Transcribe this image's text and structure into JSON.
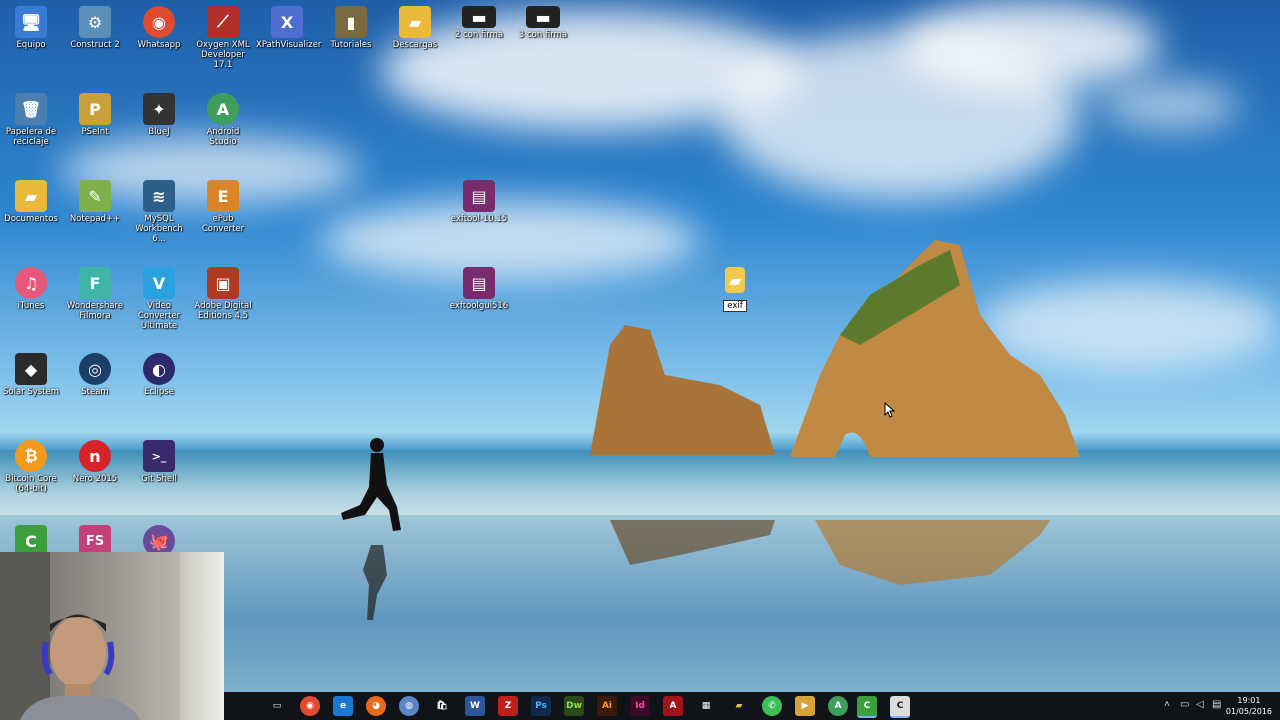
{
  "desktop_icons": [
    {
      "label": "Equipo",
      "glyph": "🖥",
      "color": "#3a7bd5"
    },
    {
      "label": "Construct 2",
      "glyph": "⚙",
      "color": "#5b8fb9"
    },
    {
      "label": "Whatsapp",
      "glyph": "◉",
      "color": "#e04a2f"
    },
    {
      "label": "Oxygen XML Developer 17.1",
      "glyph": "⟋",
      "color": "#b2302a"
    },
    {
      "label": "XPathVisualizer",
      "glyph": "X",
      "color": "#4f6fd0"
    },
    {
      "label": "Tutoriales",
      "glyph": "▮",
      "color": "#7a6a40"
    },
    {
      "label": "Descargas",
      "glyph": "▰",
      "color": "#e8b93a"
    },
    {
      "label": "2 con firma",
      "glyph": "▬",
      "color": "#222"
    },
    {
      "label": "3 con firma",
      "glyph": "▬",
      "color": "#222"
    },
    {
      "label": "Papelera de reciclaje",
      "glyph": "🗑",
      "color": "#4b7fb0"
    },
    {
      "label": "PSeInt",
      "glyph": "P",
      "color": "#c9a13a"
    },
    {
      "label": "BlueJ",
      "glyph": "✦",
      "color": "#333"
    },
    {
      "label": "Android Studio",
      "glyph": "A",
      "color": "#3f9e5a"
    },
    {
      "label": "Documentos",
      "glyph": "▰",
      "color": "#e8b93a"
    },
    {
      "label": "Notepad++",
      "glyph": "✎",
      "color": "#7fb04a"
    },
    {
      "label": "MySQL Workbench 6...",
      "glyph": "≋",
      "color": "#2e5f8a"
    },
    {
      "label": "ePub Converter",
      "glyph": "E",
      "color": "#d9852a"
    },
    {
      "label": "exftool-10.15",
      "glyph": "▤",
      "color": "#7a2b6e"
    },
    {
      "label": "iTunes",
      "glyph": "♫",
      "color": "#e6577a"
    },
    {
      "label": "Wondershare Filmora",
      "glyph": "F",
      "color": "#3fb5a8"
    },
    {
      "label": "Video Converter Ultimate",
      "glyph": "V",
      "color": "#2aa0e0"
    },
    {
      "label": "Adobe Digital Editions 4.5",
      "glyph": "▣",
      "color": "#b03a1f"
    },
    {
      "label": "exftoolgui516",
      "glyph": "▤",
      "color": "#7a2b6e"
    },
    {
      "label": "exif",
      "glyph": "▰",
      "color": "#f2c94c"
    },
    {
      "label": "Solar System",
      "glyph": "◆",
      "color": "#2b2b2b"
    },
    {
      "label": "Steam",
      "glyph": "◎",
      "color": "#1b3f66"
    },
    {
      "label": "Eclipse",
      "glyph": "◐",
      "color": "#2c2a6a"
    },
    {
      "label": "Bitcoin Core (64-bit)",
      "glyph": "₿",
      "color": "#f29a1f"
    },
    {
      "label": "Nero 2015",
      "glyph": "n",
      "color": "#d6232a"
    },
    {
      "label": "Git Shell",
      "glyph": ">_",
      "color": "#3a2a6a"
    },
    {
      "label": "",
      "glyph": "C",
      "color": "#3d9e3d"
    },
    {
      "label": "",
      "glyph": "FS",
      "color": "#c2417a"
    },
    {
      "label": "",
      "glyph": "🐙",
      "color": "#6a4a9a"
    }
  ],
  "taskbar": {
    "apps": [
      {
        "name": "task-view",
        "glyph": "▭",
        "color": "#101418"
      },
      {
        "name": "chrome",
        "glyph": "◉",
        "color": "#e04a2f"
      },
      {
        "name": "edge",
        "glyph": "e",
        "color": "#1a78d2"
      },
      {
        "name": "firefox",
        "glyph": "◕",
        "color": "#e76a1b"
      },
      {
        "name": "globe",
        "glyph": "◍",
        "color": "#5a86c7"
      },
      {
        "name": "store",
        "glyph": "🛍",
        "color": "#101418"
      },
      {
        "name": "word",
        "glyph": "W",
        "color": "#2b579a"
      },
      {
        "name": "filezilla",
        "glyph": "Z",
        "color": "#c0201c"
      },
      {
        "name": "photoshop",
        "glyph": "Ps",
        "color": "#0f2a4a"
      },
      {
        "name": "dreamweaver",
        "glyph": "Dw",
        "color": "#2b4a1a"
      },
      {
        "name": "illustrator",
        "glyph": "Ai",
        "color": "#3a1a0a"
      },
      {
        "name": "indesign",
        "glyph": "Id",
        "color": "#3a0a2a"
      },
      {
        "name": "acrobat",
        "glyph": "A",
        "color": "#a0131a"
      },
      {
        "name": "calculator",
        "glyph": "▦",
        "color": "#101418"
      },
      {
        "name": "file-explorer",
        "glyph": "▰",
        "color": "#e8b93a"
      },
      {
        "name": "whatsapp",
        "glyph": "✆",
        "color": "#3fbf5a"
      },
      {
        "name": "media",
        "glyph": "▶",
        "color": "#d9a13a"
      },
      {
        "name": "android-studio",
        "glyph": "A",
        "color": "#3f9e5a"
      },
      {
        "name": "construct",
        "glyph": "C",
        "color": "#3d9e3d"
      },
      {
        "name": "terminal",
        "glyph": "C",
        "color": "#dcdcdc"
      }
    ],
    "time": "19:01",
    "date": "01/05/2016"
  }
}
